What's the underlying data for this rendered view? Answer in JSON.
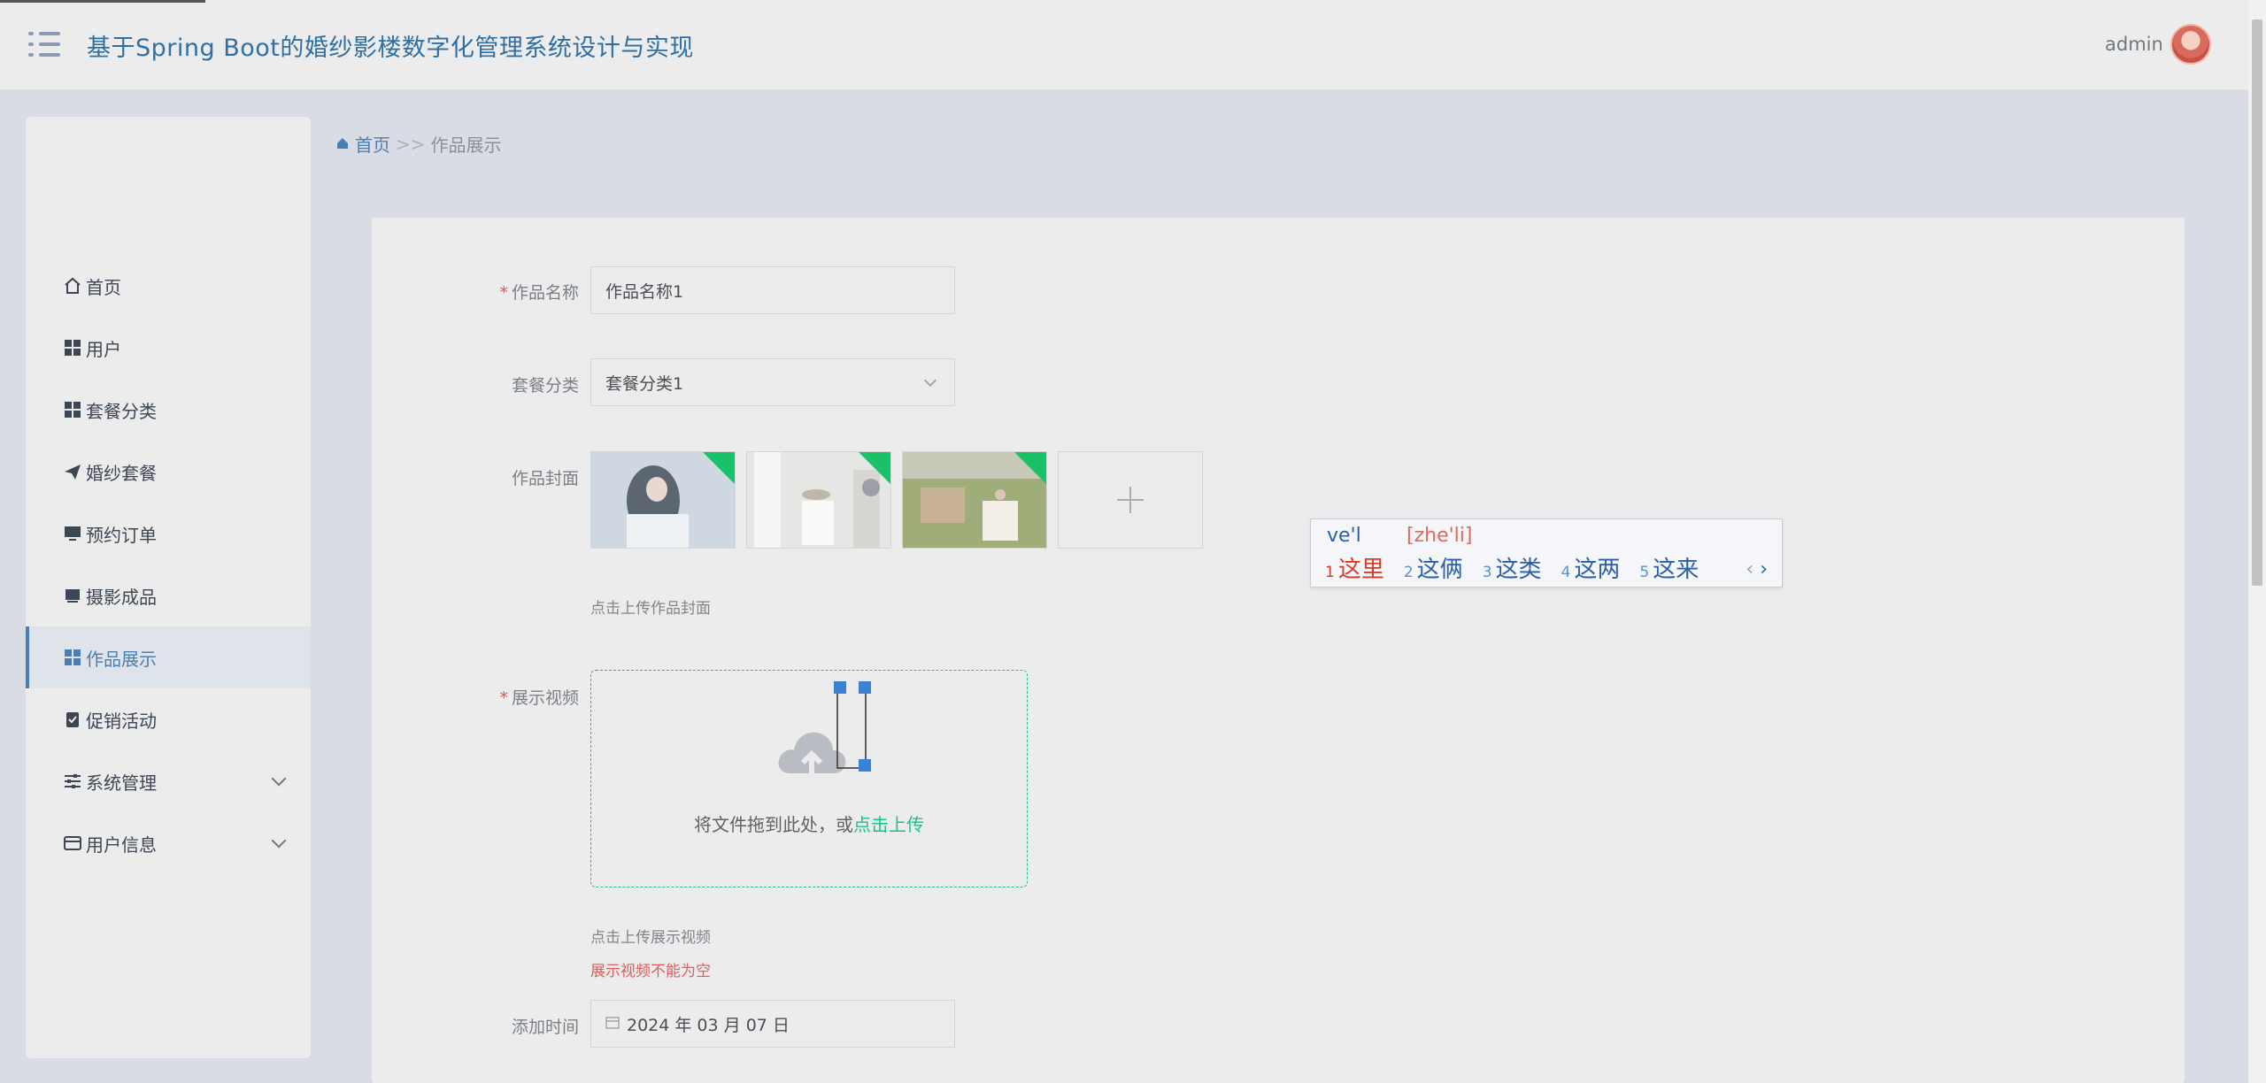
{
  "header": {
    "title": "基于Spring Boot的婚纱影楼数字化管理系统设计与实现",
    "user": "admin"
  },
  "sidebar": {
    "items": [
      {
        "label": "首页",
        "icon": "home-icon"
      },
      {
        "label": "用户",
        "icon": "grid-icon"
      },
      {
        "label": "套餐分类",
        "icon": "grid-icon"
      },
      {
        "label": "婚纱套餐",
        "icon": "paper-plane-icon"
      },
      {
        "label": "预约订单",
        "icon": "monitor-icon"
      },
      {
        "label": "摄影成品",
        "icon": "inbox-icon"
      },
      {
        "label": "作品展示",
        "icon": "grid-icon",
        "active": true
      },
      {
        "label": "促销活动",
        "icon": "clipboard-check-icon"
      },
      {
        "label": "系统管理",
        "icon": "sliders-icon",
        "expandable": true
      },
      {
        "label": "用户信息",
        "icon": "wallet-icon",
        "expandable": true
      }
    ]
  },
  "breadcrumb": {
    "home": "首页",
    "separator": ">>",
    "current": "作品展示"
  },
  "form": {
    "name": {
      "label": "作品名称",
      "value": "作品名称1",
      "required": true
    },
    "category": {
      "label": "套餐分类",
      "value": "套餐分类1"
    },
    "cover": {
      "label": "作品封面",
      "hint": "点击上传作品封面"
    },
    "video": {
      "label": "展示视频",
      "required": true,
      "drop_text": "将文件拖到此处，或",
      "drop_link": "点击上传",
      "hint": "点击上传展示视频",
      "error": "展示视频不能为空"
    },
    "time": {
      "label": "添加时间",
      "value": "2024 年 03 月 07 日"
    }
  },
  "ime": {
    "composition": "ve'l",
    "pinyin": "[zhe'li]",
    "candidates": [
      {
        "num": "1",
        "text": "这里"
      },
      {
        "num": "2",
        "text": "这俩"
      },
      {
        "num": "3",
        "text": "这类"
      },
      {
        "num": "4",
        "text": "这两"
      },
      {
        "num": "5",
        "text": "这来"
      }
    ],
    "prev": "‹",
    "next": "›"
  },
  "colors": {
    "accent": "#4a7fb5",
    "upload_accent": "#19c289",
    "error": "#e05d5d",
    "title": "#2f6fa4"
  }
}
